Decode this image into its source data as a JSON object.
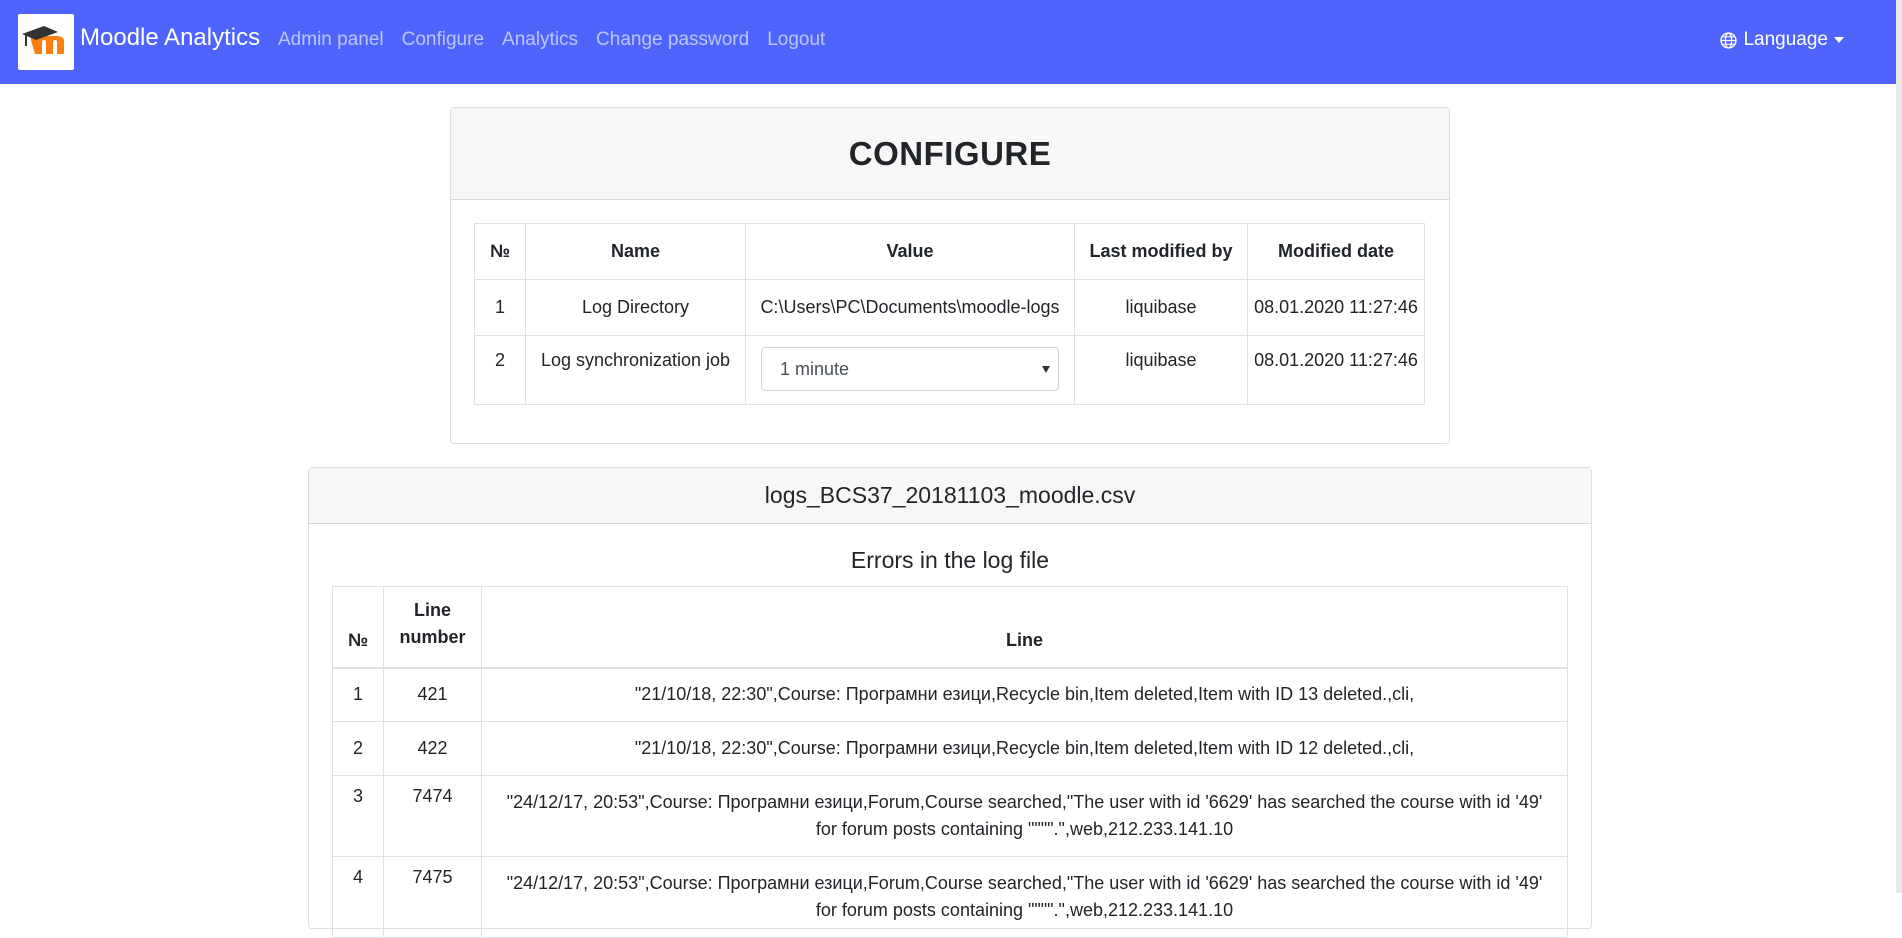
{
  "navbar": {
    "brand": "Moodle Analytics",
    "links": [
      "Admin panel",
      "Configure",
      "Analytics",
      "Change password",
      "Logout"
    ],
    "language": "Language",
    "bg_color": "#4f64fd"
  },
  "configure": {
    "title": "CONFIGURE",
    "headers": [
      "№",
      "Name",
      "Value",
      "Last modified by",
      "Modified date"
    ],
    "rows": [
      {
        "no": "1",
        "name": "Log Directory",
        "value": "C:\\Users\\PC\\Documents\\moodle-logs",
        "modified_by": "liquibase",
        "date": "08.01.2020 11:27:46"
      },
      {
        "no": "2",
        "name": "Log synchronization job",
        "value": "1 minute",
        "modified_by": "liquibase",
        "date": "08.01.2020 11:27:46"
      }
    ]
  },
  "logfile": {
    "name": "logs_BCS37_20181103_moodle.csv",
    "subtitle": "Errors in the log file",
    "headers": [
      "№",
      "Line number",
      "Line"
    ],
    "rows": [
      {
        "no": "1",
        "line_number": "421",
        "line": "\"21/10/18, 22:30\",Course: Програмни езици,Recycle bin,Item deleted,Item with ID 13 deleted.,cli,"
      },
      {
        "no": "2",
        "line_number": "422",
        "line": "\"21/10/18, 22:30\",Course: Програмни езици,Recycle bin,Item deleted,Item with ID 12 deleted.,cli,"
      },
      {
        "no": "3",
        "line_number": "7474",
        "line": "\"24/12/17, 20:53\",Course: Програмни езици,Forum,Course searched,\"The user with id '6629' has searched the course with id '49' for forum posts containing \"\"\"\".\",web,212.233.141.10"
      },
      {
        "no": "4",
        "line_number": "7475",
        "line": "\"24/12/17, 20:53\",Course: Програмни езици,Forum,Course searched,\"The user with id '6629' has searched the course with id '49' for forum posts containing \"\"\"\".\",web,212.233.141.10"
      }
    ]
  }
}
